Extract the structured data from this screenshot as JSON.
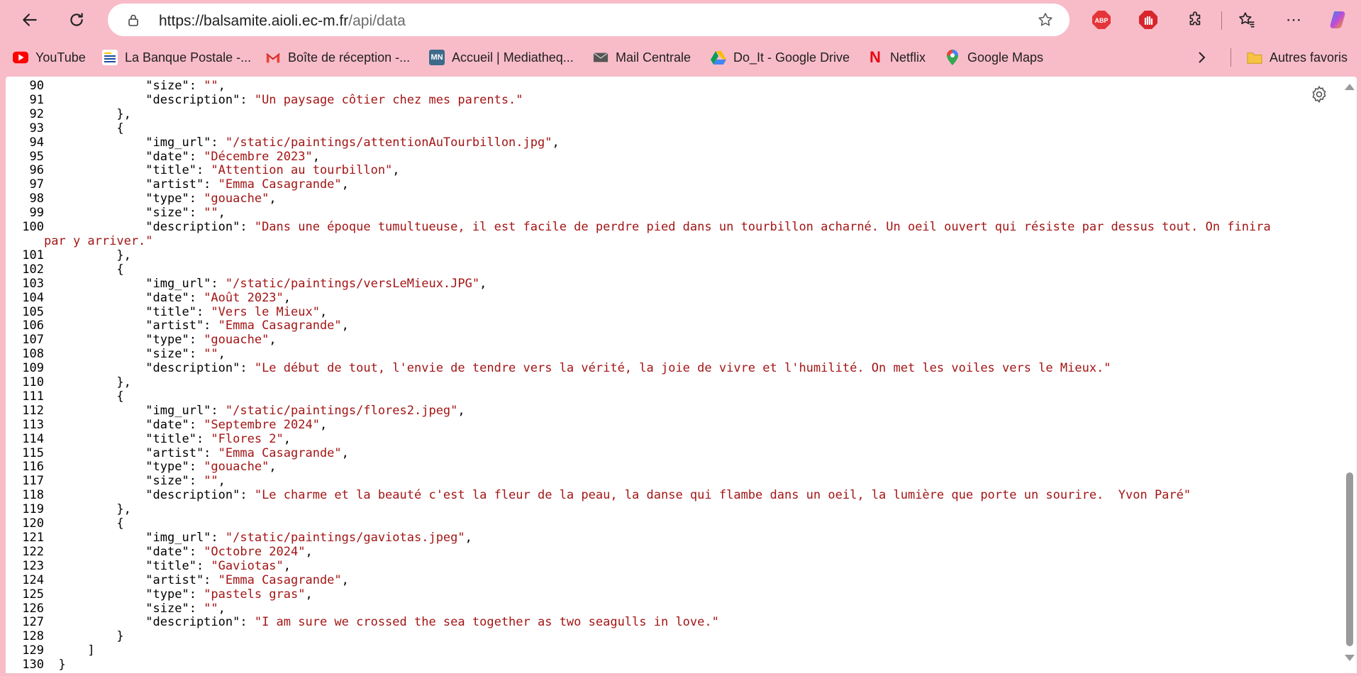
{
  "browser": {
    "url_host": "https://balsamite.aioli.ec-m.fr",
    "url_path": "/api/data",
    "accent_color": "#f8bcc9"
  },
  "extensions": [
    {
      "name": "adblock-icon",
      "label": "ABP"
    },
    {
      "name": "hand-stop-icon",
      "label": ""
    },
    {
      "name": "puzzle-icon",
      "label": ""
    },
    {
      "name": "favorites-star-icon",
      "label": ""
    },
    {
      "name": "more-icon",
      "label": "⋯"
    }
  ],
  "bookmarks": [
    {
      "label": "YouTube",
      "icon": "youtube-icon"
    },
    {
      "label": "La Banque Postale -...",
      "icon": "banque-postale-icon"
    },
    {
      "label": "Boîte de réception -...",
      "icon": "gmail-icon"
    },
    {
      "label": "Accueil | Mediatheq...",
      "icon": "mediatheque-icon",
      "icon_text": "MN"
    },
    {
      "label": "Mail Centrale",
      "icon": "mail-icon"
    },
    {
      "label": "Do_It - Google Drive",
      "icon": "google-drive-icon"
    },
    {
      "label": "Netflix",
      "icon": "netflix-icon",
      "icon_text": "N"
    },
    {
      "label": "Google Maps",
      "icon": "google-maps-icon"
    }
  ],
  "other_bookmarks": "Autres favoris",
  "code_lines": [
    {
      "n": "90",
      "parts": [
        [
          "t",
          "            \"size\": "
        ],
        [
          "s",
          "\"\""
        ],
        [
          "t",
          ","
        ]
      ]
    },
    {
      "n": "91",
      "parts": [
        [
          "t",
          "            \"description\": "
        ],
        [
          "s",
          "\"Un paysage côtier chez mes parents.\""
        ]
      ]
    },
    {
      "n": "92",
      "parts": [
        [
          "t",
          "        },"
        ]
      ]
    },
    {
      "n": "93",
      "parts": [
        [
          "t",
          "        {"
        ]
      ]
    },
    {
      "n": "94",
      "parts": [
        [
          "t",
          "            \"img_url\": "
        ],
        [
          "s",
          "\"/static/paintings/attentionAuTourbillon.jpg\""
        ],
        [
          "t",
          ","
        ]
      ]
    },
    {
      "n": "95",
      "parts": [
        [
          "t",
          "            \"date\": "
        ],
        [
          "s",
          "\"Décembre 2023\""
        ],
        [
          "t",
          ","
        ]
      ]
    },
    {
      "n": "96",
      "parts": [
        [
          "t",
          "            \"title\": "
        ],
        [
          "s",
          "\"Attention au tourbillon\""
        ],
        [
          "t",
          ","
        ]
      ]
    },
    {
      "n": "97",
      "parts": [
        [
          "t",
          "            \"artist\": "
        ],
        [
          "s",
          "\"Emma Casagrande\""
        ],
        [
          "t",
          ","
        ]
      ]
    },
    {
      "n": "98",
      "parts": [
        [
          "t",
          "            \"type\": "
        ],
        [
          "s",
          "\"gouache\""
        ],
        [
          "t",
          ","
        ]
      ]
    },
    {
      "n": "99",
      "parts": [
        [
          "t",
          "            \"size\": "
        ],
        [
          "s",
          "\"\""
        ],
        [
          "t",
          ","
        ]
      ]
    },
    {
      "n": "100",
      "parts": [
        [
          "t",
          "            \"description\": "
        ],
        [
          "s",
          "\"Dans une époque tumultueuse, il est facile de perdre pied dans un tourbillon acharné. Un oeil ouvert qui résiste par dessus tout. On finira"
        ]
      ]
    },
    {
      "n": "",
      "parts": [
        [
          "s",
          "par y arriver.\""
        ]
      ]
    },
    {
      "n": "101",
      "parts": [
        [
          "t",
          "        },"
        ]
      ]
    },
    {
      "n": "102",
      "parts": [
        [
          "t",
          "        {"
        ]
      ]
    },
    {
      "n": "103",
      "parts": [
        [
          "t",
          "            \"img_url\": "
        ],
        [
          "s",
          "\"/static/paintings/versLeMieux.JPG\""
        ],
        [
          "t",
          ","
        ]
      ]
    },
    {
      "n": "104",
      "parts": [
        [
          "t",
          "            \"date\": "
        ],
        [
          "s",
          "\"Août 2023\""
        ],
        [
          "t",
          ","
        ]
      ]
    },
    {
      "n": "105",
      "parts": [
        [
          "t",
          "            \"title\": "
        ],
        [
          "s",
          "\"Vers le Mieux\""
        ],
        [
          "t",
          ","
        ]
      ]
    },
    {
      "n": "106",
      "parts": [
        [
          "t",
          "            \"artist\": "
        ],
        [
          "s",
          "\"Emma Casagrande\""
        ],
        [
          "t",
          ","
        ]
      ]
    },
    {
      "n": "107",
      "parts": [
        [
          "t",
          "            \"type\": "
        ],
        [
          "s",
          "\"gouache\""
        ],
        [
          "t",
          ","
        ]
      ]
    },
    {
      "n": "108",
      "parts": [
        [
          "t",
          "            \"size\": "
        ],
        [
          "s",
          "\"\""
        ],
        [
          "t",
          ","
        ]
      ]
    },
    {
      "n": "109",
      "parts": [
        [
          "t",
          "            \"description\": "
        ],
        [
          "s",
          "\"Le début de tout, l'envie de tendre vers la vérité, la joie de vivre et l'humilité. On met les voiles vers le Mieux.\""
        ]
      ]
    },
    {
      "n": "110",
      "parts": [
        [
          "t",
          "        },"
        ]
      ]
    },
    {
      "n": "111",
      "parts": [
        [
          "t",
          "        {"
        ]
      ]
    },
    {
      "n": "112",
      "parts": [
        [
          "t",
          "            \"img_url\": "
        ],
        [
          "s",
          "\"/static/paintings/flores2.jpeg\""
        ],
        [
          "t",
          ","
        ]
      ]
    },
    {
      "n": "113",
      "parts": [
        [
          "t",
          "            \"date\": "
        ],
        [
          "s",
          "\"Septembre 2024\""
        ],
        [
          "t",
          ","
        ]
      ]
    },
    {
      "n": "114",
      "parts": [
        [
          "t",
          "            \"title\": "
        ],
        [
          "s",
          "\"Flores 2\""
        ],
        [
          "t",
          ","
        ]
      ]
    },
    {
      "n": "115",
      "parts": [
        [
          "t",
          "            \"artist\": "
        ],
        [
          "s",
          "\"Emma Casagrande\""
        ],
        [
          "t",
          ","
        ]
      ]
    },
    {
      "n": "116",
      "parts": [
        [
          "t",
          "            \"type\": "
        ],
        [
          "s",
          "\"gouache\""
        ],
        [
          "t",
          ","
        ]
      ]
    },
    {
      "n": "117",
      "parts": [
        [
          "t",
          "            \"size\": "
        ],
        [
          "s",
          "\"\""
        ],
        [
          "t",
          ","
        ]
      ]
    },
    {
      "n": "118",
      "parts": [
        [
          "t",
          "            \"description\": "
        ],
        [
          "s",
          "\"Le charme et la beauté c'est la fleur de la peau, la danse qui flambe dans un oeil, la lumière que porte un sourire.  Yvon Paré\""
        ]
      ]
    },
    {
      "n": "119",
      "parts": [
        [
          "t",
          "        },"
        ]
      ]
    },
    {
      "n": "120",
      "parts": [
        [
          "t",
          "        {"
        ]
      ]
    },
    {
      "n": "121",
      "parts": [
        [
          "t",
          "            \"img_url\": "
        ],
        [
          "s",
          "\"/static/paintings/gaviotas.jpeg\""
        ],
        [
          "t",
          ","
        ]
      ]
    },
    {
      "n": "122",
      "parts": [
        [
          "t",
          "            \"date\": "
        ],
        [
          "s",
          "\"Octobre 2024\""
        ],
        [
          "t",
          ","
        ]
      ]
    },
    {
      "n": "123",
      "parts": [
        [
          "t",
          "            \"title\": "
        ],
        [
          "s",
          "\"Gaviotas\""
        ],
        [
          "t",
          ","
        ]
      ]
    },
    {
      "n": "124",
      "parts": [
        [
          "t",
          "            \"artist\": "
        ],
        [
          "s",
          "\"Emma Casagrande\""
        ],
        [
          "t",
          ","
        ]
      ]
    },
    {
      "n": "125",
      "parts": [
        [
          "t",
          "            \"type\": "
        ],
        [
          "s",
          "\"pastels gras\""
        ],
        [
          "t",
          ","
        ]
      ]
    },
    {
      "n": "126",
      "parts": [
        [
          "t",
          "            \"size\": "
        ],
        [
          "s",
          "\"\""
        ],
        [
          "t",
          ","
        ]
      ]
    },
    {
      "n": "127",
      "parts": [
        [
          "t",
          "            \"description\": "
        ],
        [
          "s",
          "\"I am sure we crossed the sea together as two seagulls in love.\""
        ]
      ]
    },
    {
      "n": "128",
      "parts": [
        [
          "t",
          "        }"
        ]
      ]
    },
    {
      "n": "129",
      "parts": [
        [
          "t",
          "    ]"
        ]
      ]
    },
    {
      "n": "130",
      "parts": [
        [
          "t",
          "}"
        ]
      ]
    }
  ]
}
